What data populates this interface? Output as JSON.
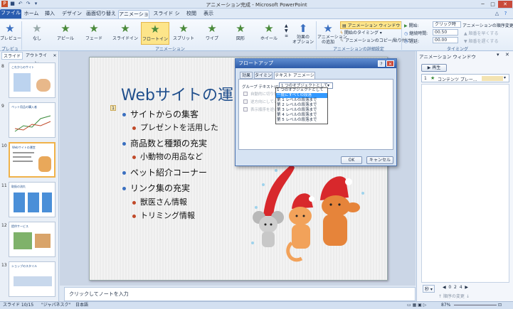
{
  "window": {
    "title": "アニメーション完成 - Microsoft PowerPoint",
    "controls": [
      "─",
      "□",
      "✕"
    ]
  },
  "qat": {
    "icons": [
      "powerpoint-app-icon",
      "save-icon",
      "undo-icon",
      "redo-icon",
      "customize-qat-icon"
    ],
    "glyphs": [
      "P",
      "■",
      "↶",
      "↷",
      "▾"
    ]
  },
  "ribbon_tabs": [
    "ファイル",
    "ホーム",
    "挿入",
    "デザイン",
    "画面切り替え",
    "アニメーション",
    "スライド ショー",
    "校閲",
    "表示"
  ],
  "active_tab": "アニメーション",
  "ribbon": {
    "preview": {
      "label": "プレビュー",
      "group": "プレビュー"
    },
    "animations": [
      {
        "label": "なし",
        "icon": "none-star-icon"
      },
      {
        "label": "アピール",
        "icon": "appear-star-icon"
      },
      {
        "label": "フェード",
        "icon": "fade-star-icon"
      },
      {
        "label": "スライドイン",
        "icon": "fly-in-star-icon"
      },
      {
        "label": "フロートイン",
        "icon": "float-in-star-icon"
      },
      {
        "label": "スプリット",
        "icon": "split-star-icon"
      },
      {
        "label": "ワイプ",
        "icon": "wipe-star-icon"
      },
      {
        "label": "図形",
        "icon": "shape-star-icon"
      },
      {
        "label": "ホイール",
        "icon": "wheel-star-icon"
      }
    ],
    "selected_animation": "フロートイン",
    "effect_options": "効果の\nオプション",
    "animation_group": "アニメーション",
    "add_animation": "アニメーション\nの追加",
    "animation_pane_btn": "アニメーション ウィンドウ",
    "trigger_btn": "開始のタイミング",
    "painter_btn": "アニメーションのコピー/貼り付け",
    "advanced_group": "アニメーションの詳細設定",
    "timing": {
      "start_label": "開始:",
      "start_value": "クリック時",
      "duration_label": "継続時間:",
      "duration_value": "00.50",
      "delay_label": "遅延:",
      "delay_value": "00.00",
      "reorder_label": "アニメーションの順序変更",
      "earlier": "▲ 順番を早くする",
      "later": "▼ 順番を遅くする",
      "group": "タイミング"
    }
  },
  "left_pane": {
    "tabs": [
      "スライド",
      "アウトライン"
    ],
    "thumbnails": [
      {
        "num": "8",
        "title": "これからのサイト"
      },
      {
        "num": "9",
        "title": "ペット用品の購入者"
      },
      {
        "num": "10",
        "title": "Webサイトの運営"
      },
      {
        "num": "11",
        "title": "取扱の流れ"
      },
      {
        "num": "12",
        "title": "提供サービス"
      },
      {
        "num": "13",
        "title": "ショップのスタイル"
      }
    ],
    "selected": "10"
  },
  "slide": {
    "title": "Webサイトの運",
    "bullets": [
      {
        "level": 1,
        "text": "サイトからの集客"
      },
      {
        "level": 2,
        "text": "プレゼントを活用した"
      },
      {
        "level": 1,
        "text": "商品数と種類の充実"
      },
      {
        "level": 2,
        "text": "小動物の用品など"
      },
      {
        "level": 1,
        "text": "ペット紹介コーナー"
      },
      {
        "level": 1,
        "text": "リンク集の充実"
      },
      {
        "level": 2,
        "text": "獣医さん情報"
      },
      {
        "level": 2,
        "text": "トリミング情報"
      }
    ],
    "anim_marker": "1"
  },
  "notes_placeholder": "クリックしてノートを入力",
  "animation_pane": {
    "title": "アニメーション ウィンドウ",
    "play": "▶ 再生",
    "item_num": "1",
    "item_text": "コンテンツ プレー...",
    "seconds_label": "秒 ▾",
    "nav": "◀  0  2  4  ▶",
    "reorder": "↑  順序の変更  ↓"
  },
  "dialog": {
    "title": "フロートアップ",
    "help": "?",
    "close": "✕",
    "tabs": [
      "効果",
      "タイミング",
      "テキスト アニメーション"
    ],
    "active_tab": "テキスト アニメーション",
    "group_text_label": "グループ テキスト(G):",
    "group_text_value": "1 つのオブジェクトとして",
    "options": [
      "1 つのオブジェクトとして",
      "一度にすべての段落",
      "第 1 レベルの段落まで",
      "第 2 レベルの段落まで",
      "第 3 レベルの段落まで",
      "第 4 レベルの段落まで",
      "第 5 レベルの段落まで"
    ],
    "highlighted_option": "一度にすべての段落",
    "checkboxes": [
      "自動的に切り替え",
      "逆方向にしている",
      "表示順序を逆にする"
    ],
    "ok": "OK",
    "cancel": "キャンセル"
  },
  "status": {
    "slide": "スライド 10/15",
    "theme": "\"ジャパネスク\"",
    "lang": "日本語",
    "zoom": "87%"
  }
}
